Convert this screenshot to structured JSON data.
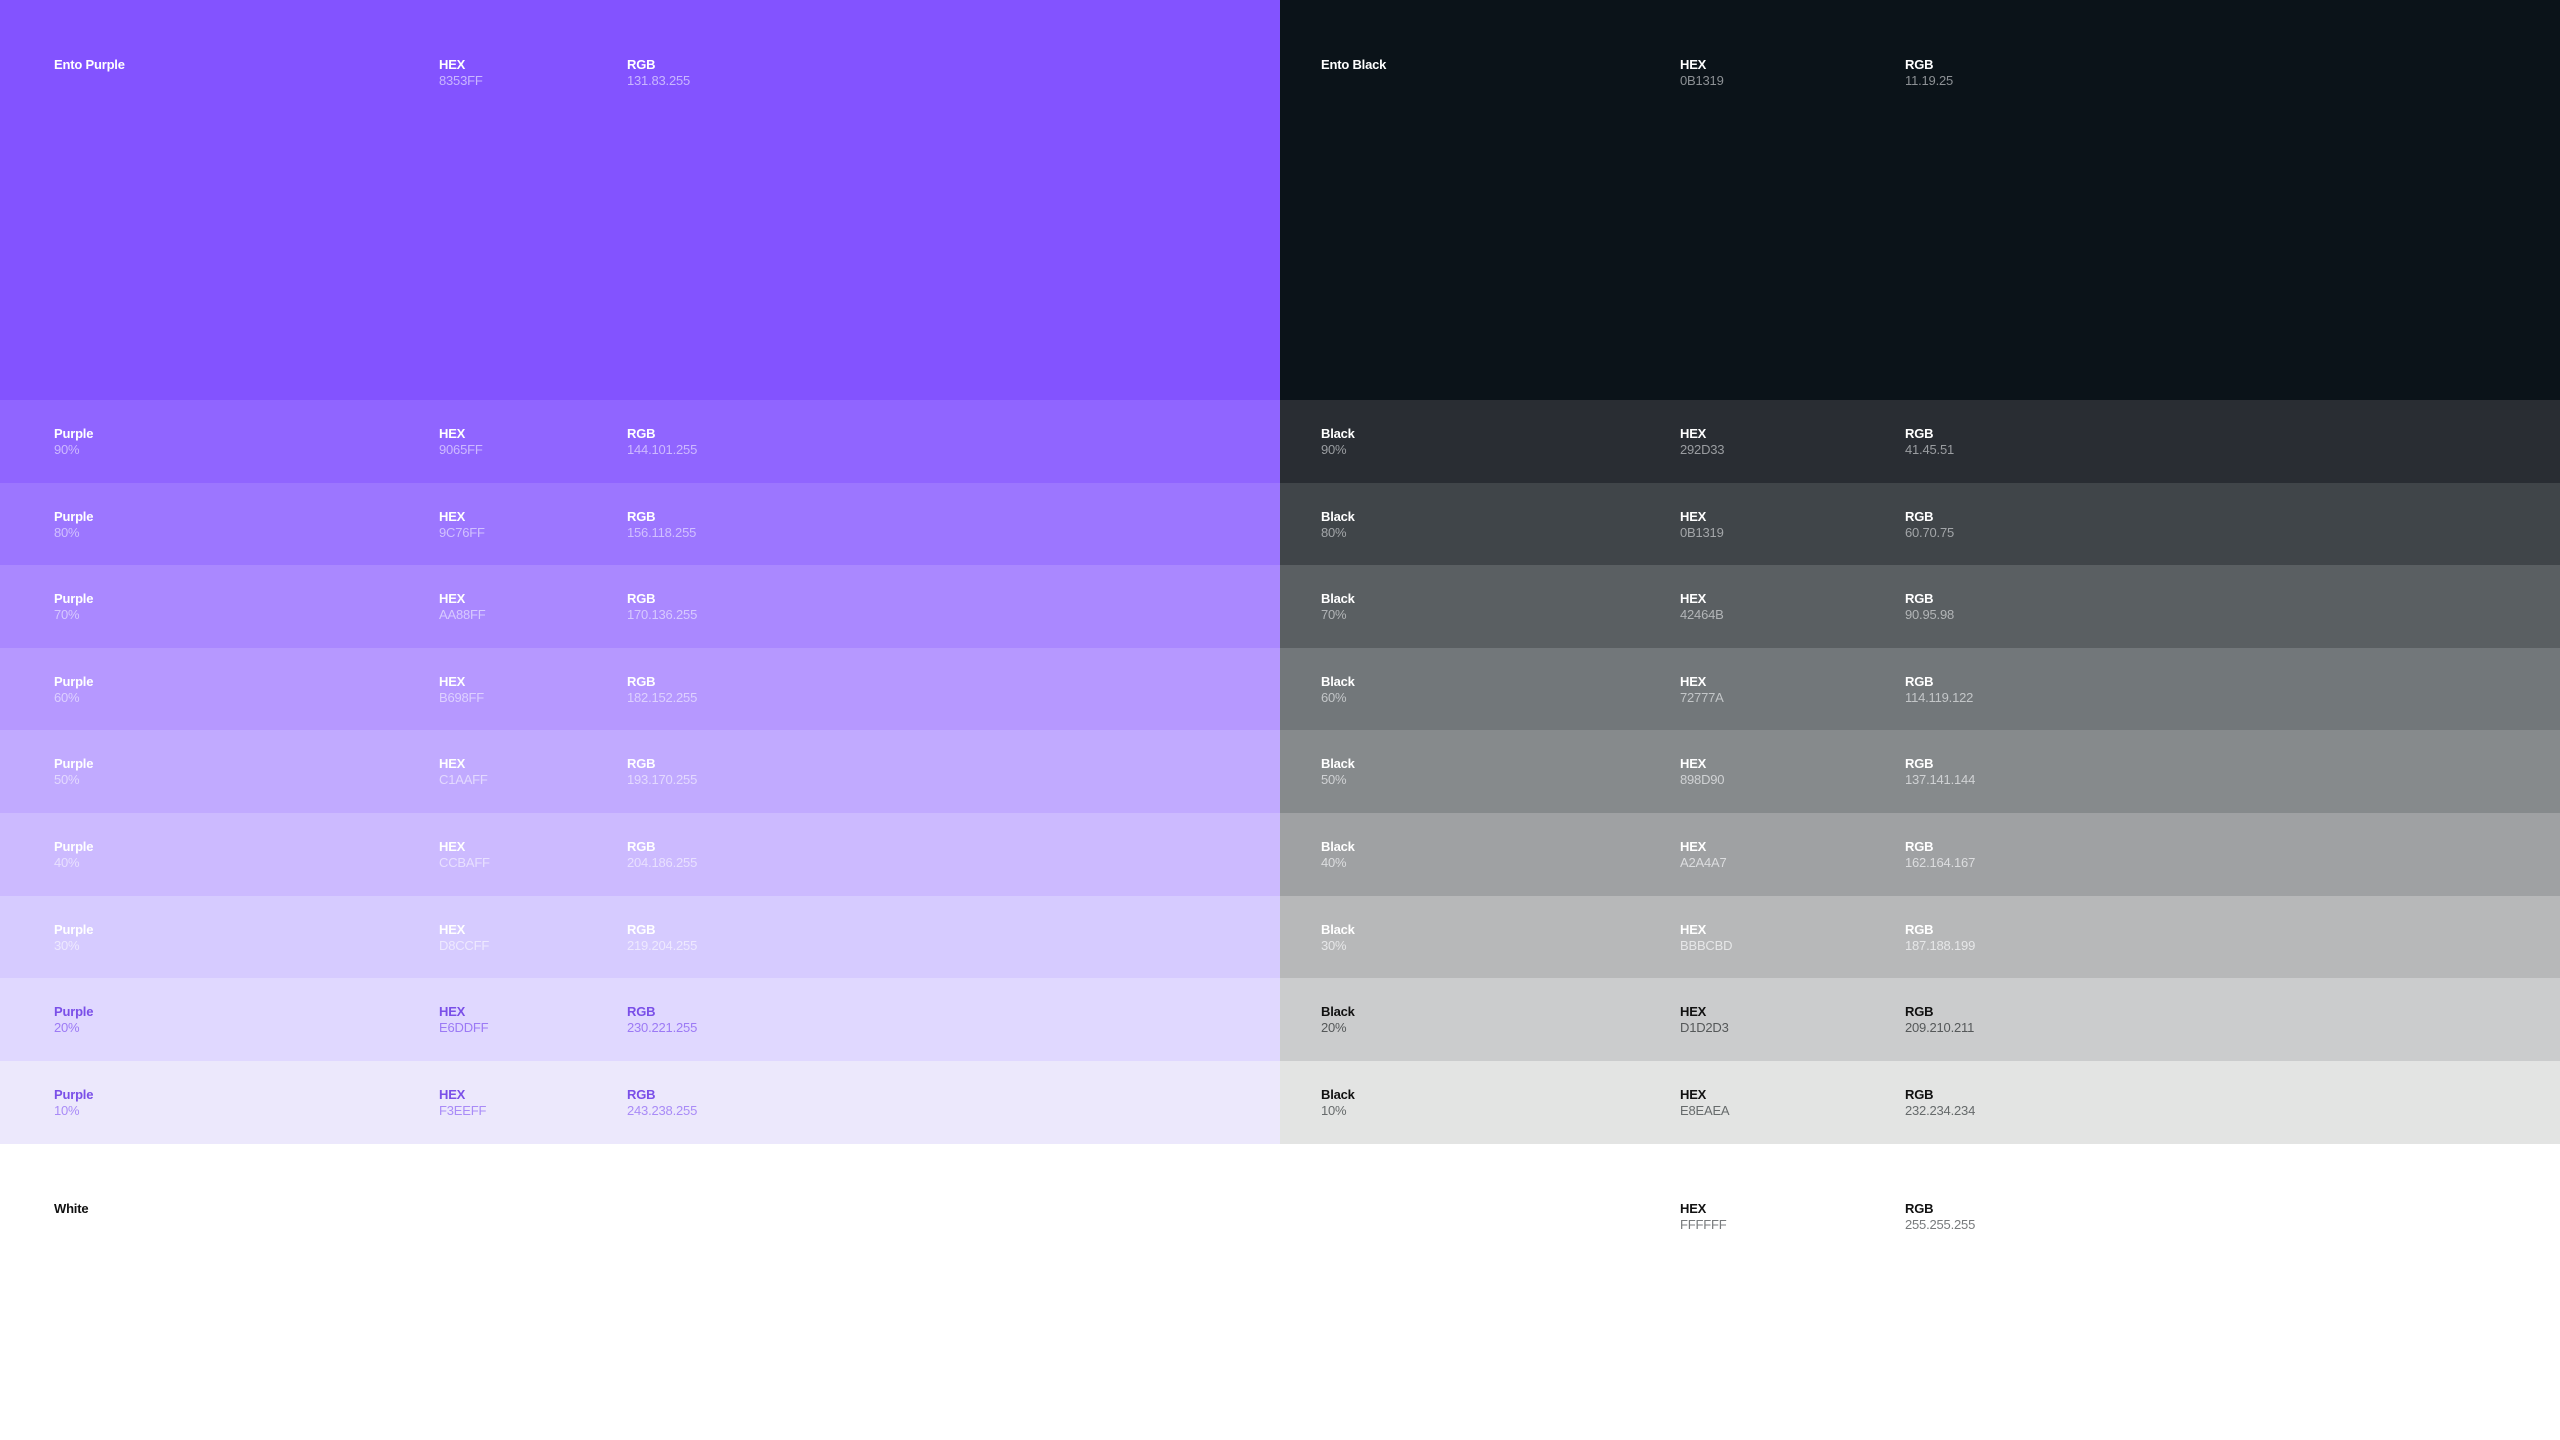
{
  "labels": {
    "hex": "HEX",
    "rgb": "RGB"
  },
  "main_swatches": [
    {
      "name": "Ento Purple",
      "hex": "8353FF",
      "rgb": "131.83.255",
      "color": "#8353FF",
      "title_color": "#FFFFFF",
      "value_color": "#C9B6FF"
    },
    {
      "name": "Ento Black",
      "hex": "0B1319",
      "rgb": "11.19.25",
      "color": "#0B1319",
      "title_color": "#FFFFFF",
      "value_color": "#8C9094"
    }
  ],
  "purple_tints": [
    {
      "name": "Purple",
      "percent": "90%",
      "hex": "9065FF",
      "rgb": "144.101.255",
      "color": "#9065FF",
      "title_color": "#FFFFFF",
      "value_color": "#CDB9FF"
    },
    {
      "name": "Purple",
      "percent": "80%",
      "hex": "9C76FF",
      "rgb": "156.118.255",
      "color": "#9C76FF",
      "title_color": "#FFFFFF",
      "value_color": "#D1C0FF"
    },
    {
      "name": "Purple",
      "percent": "70%",
      "hex": "AA88FF",
      "rgb": "170.136.255",
      "color": "#AA88FF",
      "title_color": "#FFFFFF",
      "value_color": "#D7C9FF"
    },
    {
      "name": "Purple",
      "percent": "60%",
      "hex": "B698FF",
      "rgb": "182.152.255",
      "color": "#B698FF",
      "title_color": "#FFFFFF",
      "value_color": "#DDD0FF"
    },
    {
      "name": "Purple",
      "percent": "50%",
      "hex": "C1AAFF",
      "rgb": "193.170.255",
      "color": "#C1AAFF",
      "title_color": "#FFFFFF",
      "value_color": "#E3D9FF"
    },
    {
      "name": "Purple",
      "percent": "40%",
      "hex": "CCBAFF",
      "rgb": "204.186.255",
      "color": "#CCBAFF",
      "title_color": "#FFFFFF",
      "value_color": "#E8E0FF"
    },
    {
      "name": "Purple",
      "percent": "30%",
      "hex": "D8CCFF",
      "rgb": "219.204.255",
      "color": "#D6CBFF",
      "title_color": "#FFFFFF",
      "value_color": "#EEE9FF"
    },
    {
      "name": "Purple",
      "percent": "20%",
      "hex": "E6DDFF",
      "rgb": "230.221.255",
      "color": "#E0D8FF",
      "title_color": "#7A4FE8",
      "value_color": "#9C7AF5"
    },
    {
      "name": "Purple",
      "percent": "10%",
      "hex": "F3EEFF",
      "rgb": "243.238.255",
      "color": "#ECE8FC",
      "title_color": "#7A4FE8",
      "value_color": "#A98BF7"
    }
  ],
  "black_tints": [
    {
      "name": "Black",
      "percent": "90%",
      "hex": "292D33",
      "rgb": "41.45.51",
      "color": "#292D33",
      "title_color": "#FFFFFF",
      "value_color": "#9A9DA1"
    },
    {
      "name": "Black",
      "percent": "80%",
      "hex": "0B1319",
      "rgb": "60.70.75",
      "color": "#404549",
      "title_color": "#FFFFFF",
      "value_color": "#A3A6A9"
    },
    {
      "name": "Black",
      "percent": "70%",
      "hex": "42464B",
      "rgb": "90.95.98",
      "color": "#5A5F62",
      "title_color": "#FFFFFF",
      "value_color": "#B2B5B7"
    },
    {
      "name": "Black",
      "percent": "60%",
      "hex": "72777A",
      "rgb": "114.119.122",
      "color": "#72777A",
      "title_color": "#FFFFFF",
      "value_color": "#C3C6C8"
    },
    {
      "name": "Black",
      "percent": "50%",
      "hex": "898D90",
      "rgb": "137.141.144",
      "color": "#868A8C",
      "title_color": "#FFFFFF",
      "value_color": "#D0D2D4"
    },
    {
      "name": "Black",
      "percent": "40%",
      "hex": "A2A4A7",
      "rgb": "162.164.167",
      "color": "#9FA1A3",
      "title_color": "#FFFFFF",
      "value_color": "#DCDDDF"
    },
    {
      "name": "Black",
      "percent": "30%",
      "hex": "BBBCBD",
      "rgb": "187.188.199",
      "color": "#B7B8B9",
      "title_color": "#FFFFFF",
      "value_color": "#E6E7E8"
    },
    {
      "name": "Black",
      "percent": "20%",
      "hex": "D1D2D3",
      "rgb": "209.210.211",
      "color": "#CBCCCD",
      "title_color": "#111111",
      "value_color": "#555859"
    },
    {
      "name": "Black",
      "percent": "10%",
      "hex": "E8EAEA",
      "rgb": "232.234.234",
      "color": "#E3E4E3",
      "title_color": "#111111",
      "value_color": "#666A6B"
    }
  ],
  "white": {
    "name": "White",
    "hex": "FFFFFF",
    "rgb": "255.255.255",
    "color": "#FFFFFF",
    "title_color": "#111111",
    "value_color": "#777A7C"
  }
}
